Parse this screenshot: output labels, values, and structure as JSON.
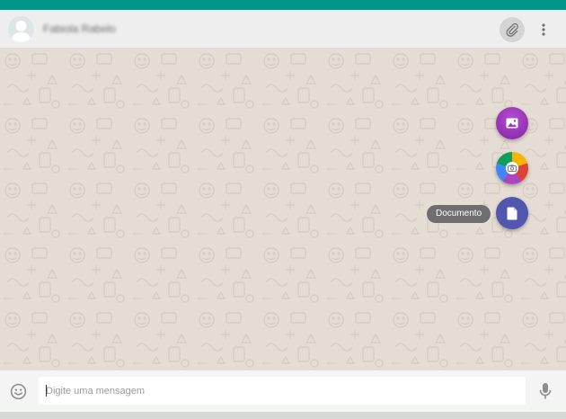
{
  "header": {
    "contact_name": "Fabiola Rabelo",
    "icons": {
      "avatar": "default-avatar-icon",
      "attach": "paperclip-icon",
      "menu": "more-vertical-icon"
    }
  },
  "attach_menu": {
    "items": [
      {
        "id": "gallery",
        "icon": "image-icon"
      },
      {
        "id": "camera",
        "icon": "camera-icon"
      },
      {
        "id": "document",
        "icon": "document-icon",
        "tooltip": "Documento"
      }
    ]
  },
  "composer": {
    "placeholder": "Digite uma mensagem",
    "value": "",
    "icons": {
      "emoji": "smiley-icon",
      "mic": "microphone-icon"
    }
  },
  "colors": {
    "topbar": "#009688",
    "chat_background": "#e5ddd4",
    "gallery_fab": "#9c3bbd",
    "document_fab": "#5157ae",
    "tooltip": "#6e6e6e"
  }
}
